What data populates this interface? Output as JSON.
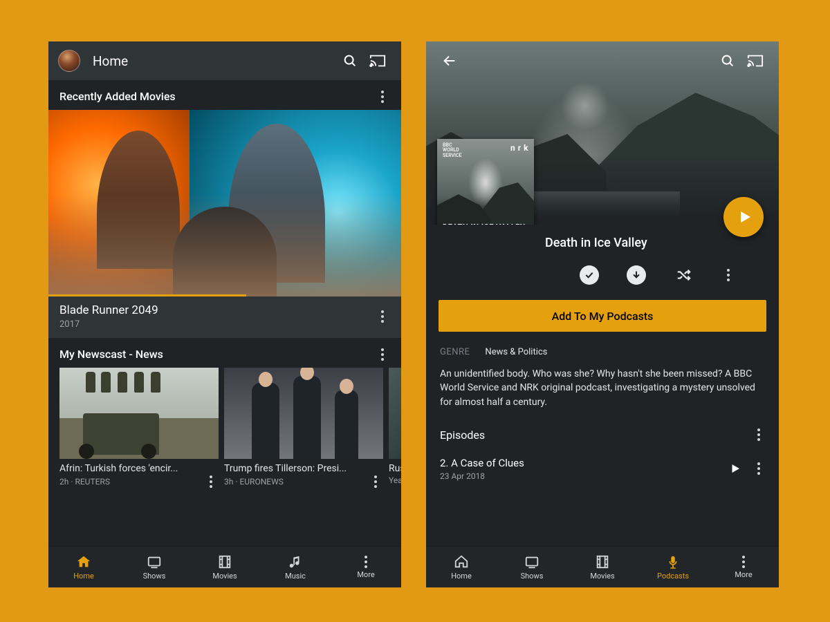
{
  "colors": {
    "accent": "#e5a00d",
    "page_bg": "#e29a14"
  },
  "phoneA": {
    "topbar": {
      "title": "Home"
    },
    "recent": {
      "header": "Recently Added Movies",
      "title": "Blade Runner 2049",
      "year": "2017",
      "progress_pct": 56
    },
    "news": {
      "header": "My Newscast - News",
      "items": [
        {
          "title": "Afrin: Turkish forces 'encir...",
          "sub": "2h · REUTERS"
        },
        {
          "title": "Trump fires Tillerson: Presi...",
          "sub": "3h · EURONEWS"
        },
        {
          "title": "Russia",
          "sub": "Year"
        }
      ]
    },
    "nav": [
      {
        "label": "Home",
        "active": true
      },
      {
        "label": "Shows",
        "active": false
      },
      {
        "label": "Movies",
        "active": false
      },
      {
        "label": "Music",
        "active": false
      },
      {
        "label": "More",
        "active": false
      }
    ]
  },
  "phoneB": {
    "podcast": {
      "cover_brand1": "BBC\nWORLD\nSERVICE",
      "cover_brand2": "n r k",
      "cover_caption": "DEATH IN ICE VALLEY",
      "title": "Death in Ice Valley",
      "add_button": "Add To My Podcasts",
      "genre_label": "GENRE",
      "genre_value": "News & Politics",
      "description": "An unidentified body. Who was she? Why hasn't she been missed? A BBC World Service and NRK original podcast, investigating a mystery unsolved for almost half a century.",
      "episodes_header": "Episodes",
      "episode": {
        "name": "2. A Case of Clues",
        "date": "23 Apr 2018"
      }
    },
    "nav": [
      {
        "label": "Home",
        "active": false
      },
      {
        "label": "Shows",
        "active": false
      },
      {
        "label": "Movies",
        "active": false
      },
      {
        "label": "Podcasts",
        "active": true
      },
      {
        "label": "More",
        "active": false
      }
    ]
  }
}
